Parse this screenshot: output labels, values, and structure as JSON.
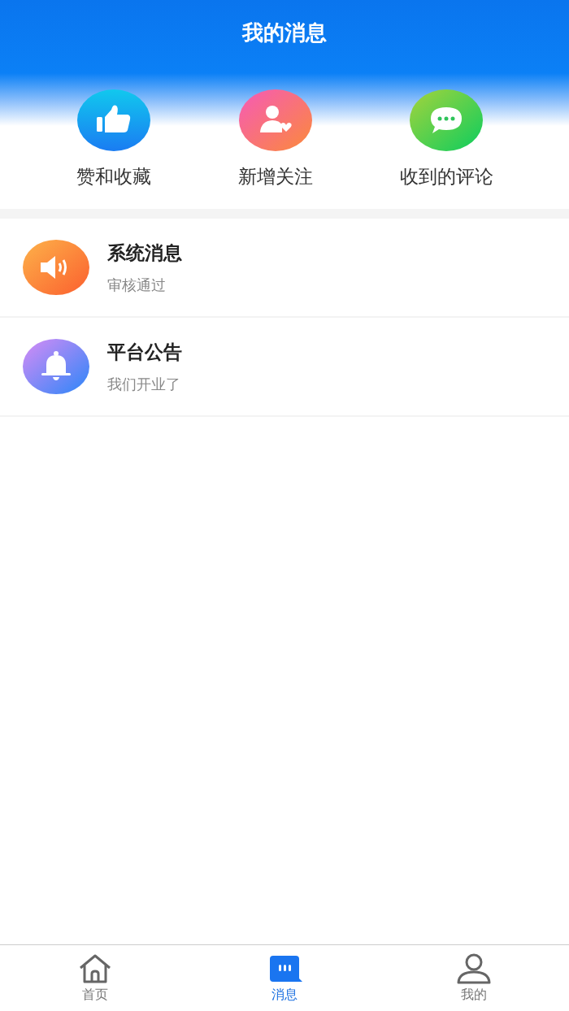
{
  "header": {
    "title": "我的消息"
  },
  "shortcuts": [
    {
      "kind": "like",
      "label": "赞和收藏"
    },
    {
      "kind": "follow",
      "label": "新增关注"
    },
    {
      "kind": "comment",
      "label": "收到的评论"
    }
  ],
  "messages": [
    {
      "kind": "speaker",
      "title": "系统消息",
      "preview": "审核通过"
    },
    {
      "kind": "bell",
      "title": "平台公告",
      "preview": "我们开业了"
    }
  ],
  "tabs": [
    {
      "kind": "home",
      "label": "首页",
      "selected": false
    },
    {
      "kind": "message",
      "label": "消息",
      "selected": true
    },
    {
      "kind": "profile",
      "label": "我的",
      "selected": false
    }
  ]
}
